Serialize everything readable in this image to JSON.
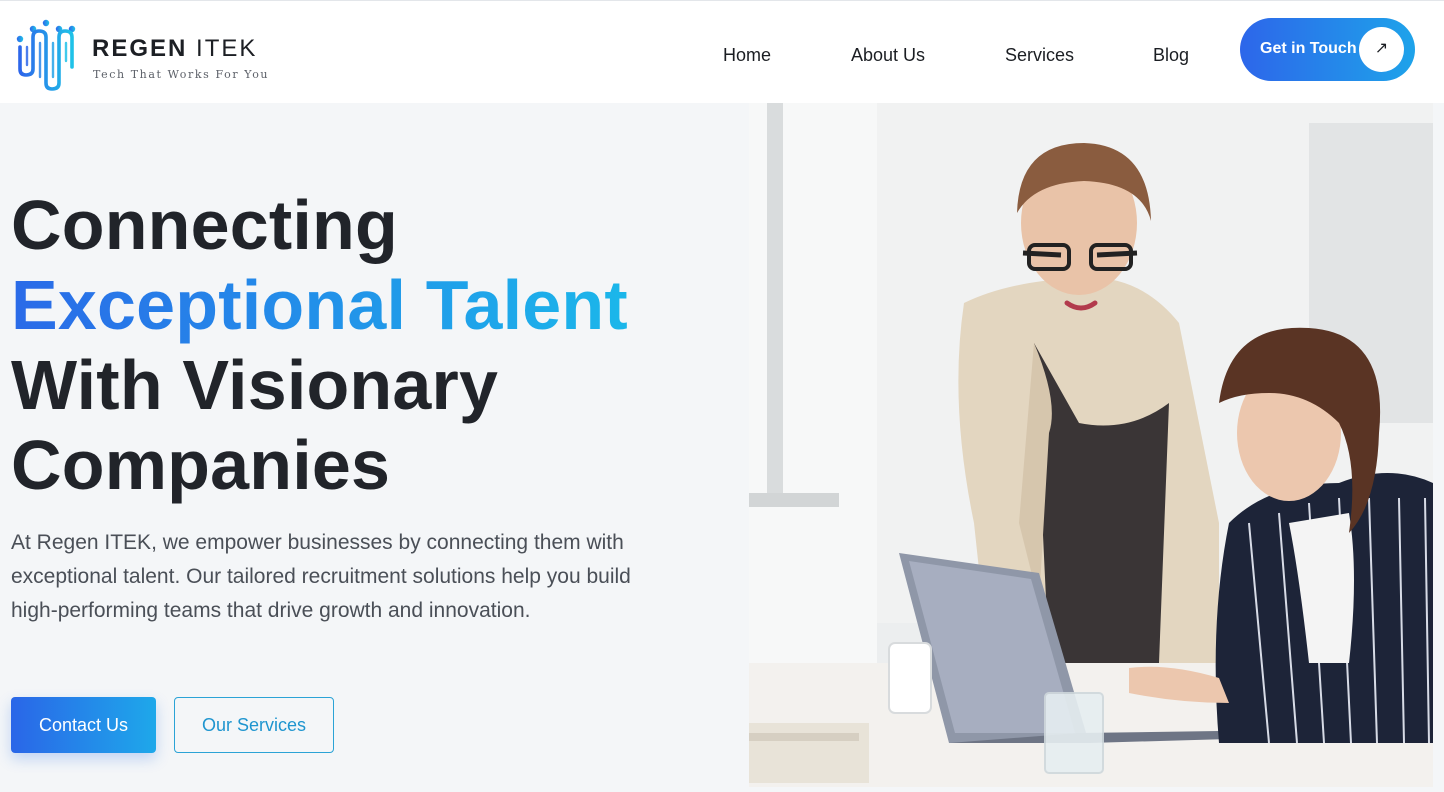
{
  "brand": {
    "name_bold": "REGEN",
    "name_light": "ITEK",
    "tagline": "Tech That Works For You",
    "colors": {
      "accent_blue": "#2d66ea",
      "accent_cyan": "#1ea8ea",
      "dark_text": "#21242a"
    }
  },
  "nav": {
    "items": [
      {
        "label": "Home"
      },
      {
        "label": "About Us"
      },
      {
        "label": "Services"
      },
      {
        "label": "Blog"
      }
    ],
    "cta_label": "Get in Touch",
    "cta_icon": "arrow-up-right-icon"
  },
  "hero": {
    "headline_1": "Connecting",
    "headline_2": "Exceptional Talent",
    "headline_3": "With Visionary",
    "headline_4": "Companies",
    "description": "At Regen ITEK, we empower businesses by connecting them with exceptional talent. Our tailored recruitment solutions help you build high-performing teams that drive growth and innovation.",
    "primary_button": "Contact Us",
    "secondary_button": "Our Services",
    "image_subject": "two-women-working-at-laptop"
  }
}
